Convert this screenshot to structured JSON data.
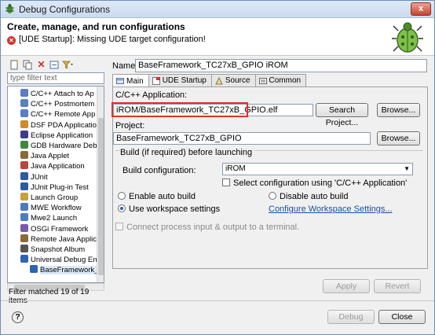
{
  "window": {
    "title": "Debug Configurations",
    "close_glyph": "x"
  },
  "header": {
    "heading": "Create, manage, and run configurations",
    "error_message": "[UDE Startup]: Missing UDE target configuration!",
    "error_icon": "error-icon",
    "banner_icon": "bug-icon"
  },
  "left": {
    "toolbar_icons": [
      "new-config-icon",
      "duplicate-icon",
      "delete-icon",
      "collapse-all-icon",
      "filter-icon"
    ],
    "filter_placeholder": "type filter text",
    "tree": [
      {
        "label": "C/C++ Attach to Ap",
        "icon": "cpp-icon",
        "color": "#5a7fbf"
      },
      {
        "label": "C/C++ Postmortem",
        "icon": "cpp-icon",
        "color": "#5a7fbf"
      },
      {
        "label": "C/C++ Remote App",
        "icon": "cpp-icon",
        "color": "#5a7fbf"
      },
      {
        "label": "DSF PDA Application",
        "icon": "dsf-icon",
        "color": "#d08a2a"
      },
      {
        "label": "Eclipse Application",
        "icon": "eclipse-icon",
        "color": "#3b3e8a"
      },
      {
        "label": "GDB Hardware Debu",
        "icon": "gdb-icon",
        "color": "#3d8a3d"
      },
      {
        "label": "Java Applet",
        "icon": "java-applet-icon",
        "color": "#8a6a3a"
      },
      {
        "label": "Java Application",
        "icon": "java-app-icon",
        "color": "#b5483a"
      },
      {
        "label": "JUnit",
        "icon": "junit-icon",
        "color": "#2d5aa0"
      },
      {
        "label": "JUnit Plug-in Test",
        "icon": "junit-plugin-icon",
        "color": "#2d5aa0"
      },
      {
        "label": "Launch Group",
        "icon": "launch-group-icon",
        "color": "#c9a13a"
      },
      {
        "label": "MWE Workflow",
        "icon": "mwe-icon",
        "color": "#4b7dbd"
      },
      {
        "label": "Mwe2 Launch",
        "icon": "mwe2-icon",
        "color": "#4b7dbd"
      },
      {
        "label": "OSGi Framework",
        "icon": "osgi-icon",
        "color": "#7a5aa8"
      },
      {
        "label": "Remote Java Applica",
        "icon": "remote-java-icon",
        "color": "#8a6a3a"
      },
      {
        "label": "Snapshot Album",
        "icon": "snapshot-icon",
        "color": "#555555"
      },
      {
        "label": "Universal Debug Eng",
        "icon": "ude-icon",
        "color": "#2b63b5"
      },
      {
        "label": "BaseFramework_",
        "icon": "ude-config-icon",
        "color": "#2b63b5",
        "child": true,
        "selected": true
      }
    ],
    "filter_message": "Filter matched 19 of 19 items"
  },
  "config": {
    "name_label": "Name:",
    "name_value": "BaseFramework_TC27xB_GPIO iROM",
    "tabs": [
      {
        "label": "Main",
        "icon": "main-tab-icon",
        "active": true
      },
      {
        "label": "UDE Startup",
        "icon": "ude-startup-icon",
        "active": false
      },
      {
        "label": "Source",
        "icon": "source-icon",
        "active": false
      },
      {
        "label": "Common",
        "icon": "common-icon",
        "active": false
      }
    ],
    "application_label": "C/C++ Application:",
    "application_value": "iROM/BaseFramework_TC27xB_GPIO.elf",
    "search_project_button": "Search Project...",
    "browse_button_1": "Browse...",
    "project_label": "Project:",
    "project_value": "BaseFramework_TC27xB_GPIO",
    "browse_button_2": "Browse...",
    "build_group_label": "Build (if required) before launching",
    "build_config_label": "Build configuration:",
    "build_config_value": "iROM",
    "select_config_label": "Select configuration using 'C/C++ Application'",
    "enable_auto_build": "Enable auto build",
    "disable_auto_build": "Disable auto build",
    "use_workspace_settings": "Use workspace settings",
    "configure_workspace_link": "Configure Workspace Settings...",
    "connect_terminal_label": "Connect process input & output to a terminal.",
    "apply_button": "Apply",
    "revert_button": "Revert"
  },
  "footer": {
    "help_icon": "help-icon",
    "help_glyph": "?",
    "debug_button": "Debug",
    "close_button": "Close"
  }
}
